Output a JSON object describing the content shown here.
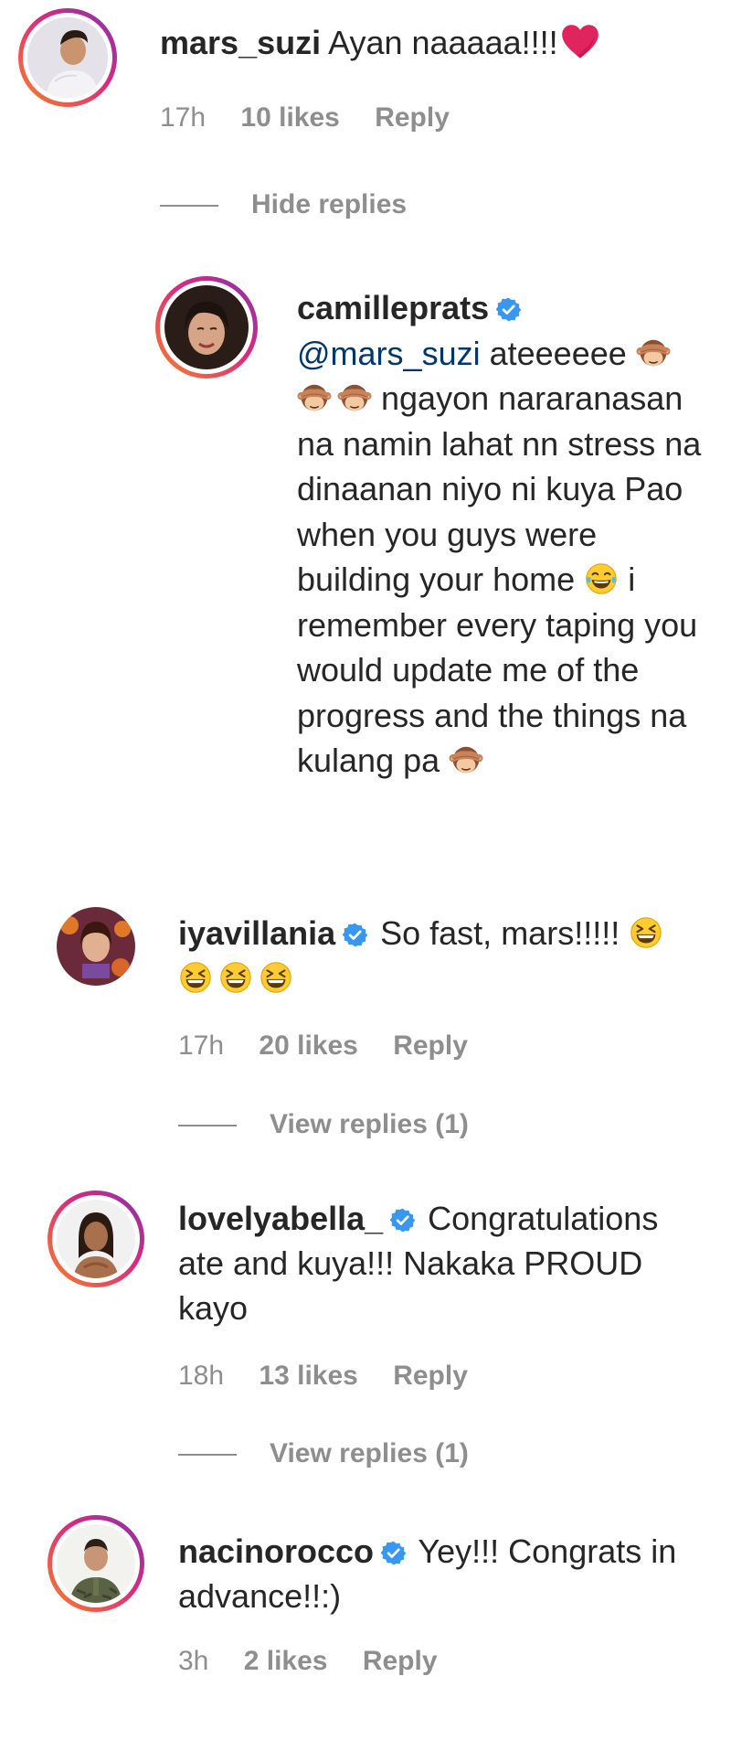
{
  "comments": [
    {
      "username": "mars_suzi",
      "text": "Ayan naaaaa!!!!",
      "time": "17h",
      "likes": "10 likes",
      "reply": "Reply",
      "toggle": "Hide replies",
      "replies": [
        {
          "username": "camilleprats",
          "mention": "@mars_suzi",
          "text_a": "ateeeeee",
          "text_b": "ngayon nararanasan na namin lahat nn stress na dinaanan niyo ni kuya Pao when you guys were building your home",
          "text_c": "i remember every taping you would update me of the progress and the things na kulang pa"
        }
      ]
    },
    {
      "username": "iyavillania",
      "text": "So fast, mars!!!!!",
      "time": "17h",
      "likes": "20 likes",
      "reply": "Reply",
      "toggle": "View replies (1)"
    },
    {
      "username": "lovelyabella_",
      "text": "Congratulations ate and kuya!!! Nakaka PROUD kayo",
      "time": "18h",
      "likes": "13 likes",
      "reply": "Reply",
      "toggle": "View replies (1)"
    },
    {
      "username": "nacinorocco",
      "text": "Yey!!! Congrats in advance!!:)",
      "time": "3h",
      "likes": "2 likes",
      "reply": "Reply"
    }
  ],
  "icons": {
    "verified": "verified-badge-icon",
    "heart": "red-heart-emoji",
    "monkey": "see-no-evil-monkey-emoji",
    "laugh_cry": "tears-of-joy-emoji",
    "grin": "grinning-squinting-emoji"
  },
  "colors": {
    "verified": "#3897f0",
    "meta": "#8e8e8e",
    "mention": "#00376b",
    "heart": "#e0245e"
  }
}
